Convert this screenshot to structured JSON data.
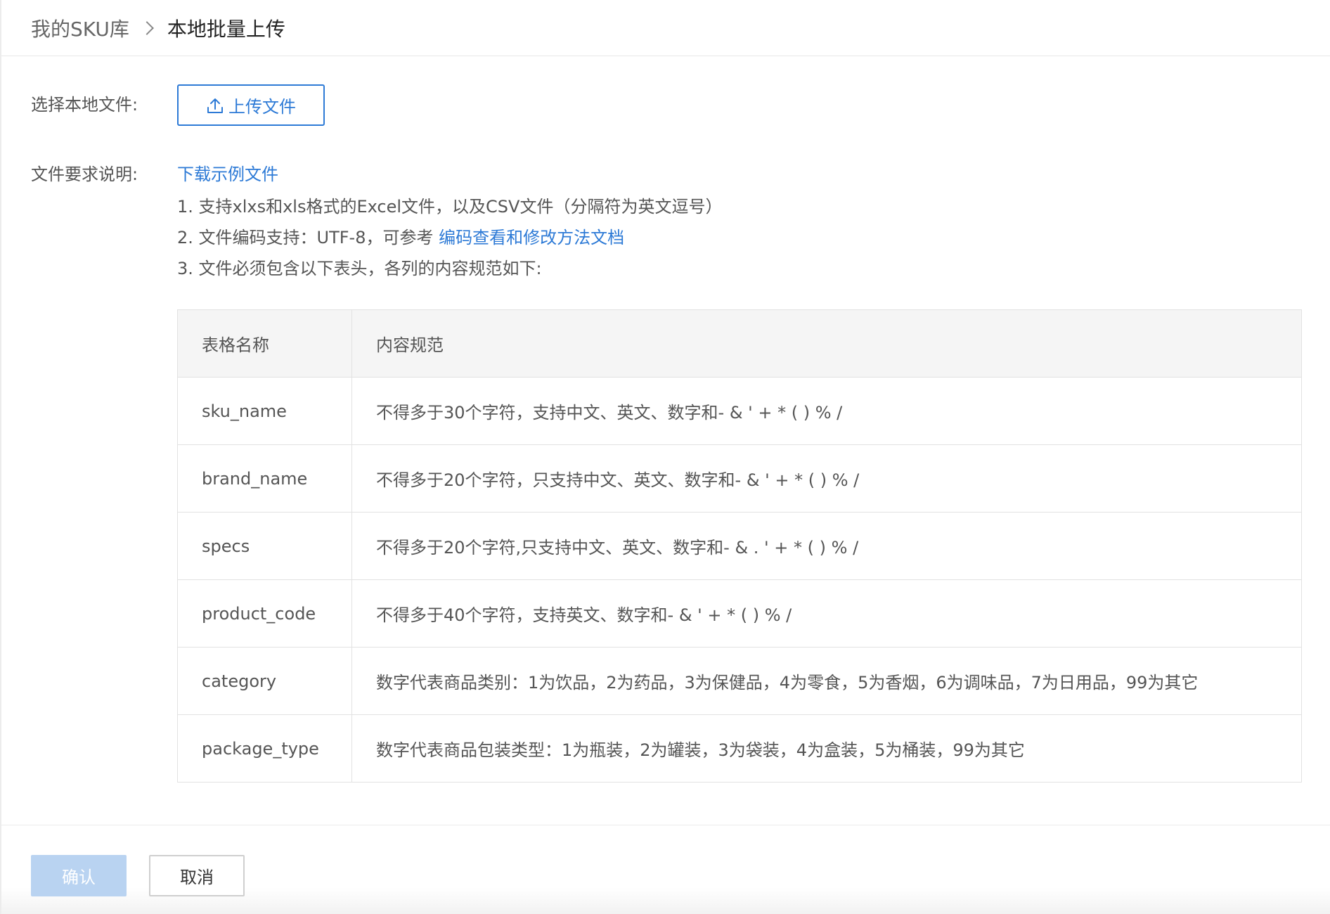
{
  "breadcrumb": {
    "parent": "我的SKU库",
    "current": "本地批量上传"
  },
  "upload": {
    "label": "选择本地文件:",
    "button_label": "上传文件"
  },
  "requirements": {
    "label": "文件要求说明:",
    "download_link": "下载示例文件",
    "line1": "1. 支持xlxs和xls格式的Excel文件，以及CSV文件（分隔符为英文逗号）",
    "line2_prefix": "2. 文件编码支持：UTF-8，可参考",
    "line2_link": "编码查看和修改方法文档",
    "line3": "3. 文件必须包含以下表头，各列的内容规范如下:"
  },
  "table": {
    "headers": [
      "表格名称",
      "内容规范"
    ],
    "rows": [
      {
        "name": "sku_name",
        "spec": "不得多于30个字符，支持中文、英文、数字和- & ' + * ( ) % /"
      },
      {
        "name": "brand_name",
        "spec": "不得多于20个字符，只支持中文、英文、数字和- & ' + * ( ) % /"
      },
      {
        "name": "specs",
        "spec": "不得多于20个字符,只支持中文、英文、数字和- & . ' + * ( ) % /"
      },
      {
        "name": "product_code",
        "spec": "不得多于40个字符，支持英文、数字和- & ' + * ( ) % /"
      },
      {
        "name": "category",
        "spec": "数字代表商品类别：1为饮品，2为药品，3为保健品，4为零食，5为香烟，6为调味品，7为日用品，99为其它"
      },
      {
        "name": "package_type",
        "spec": "数字代表商品包装类型：1为瓶装，2为罐装，3为袋装，4为盒装，5为桶装，99为其它"
      }
    ]
  },
  "footer": {
    "confirm_label": "确认",
    "cancel_label": "取消"
  },
  "colors": {
    "accent": "#2d7ad6",
    "confirm_disabled": "#b9d3f1"
  },
  "icons": {
    "upload": "upload-icon",
    "breadcrumb_separator": "chevron-right-icon"
  }
}
